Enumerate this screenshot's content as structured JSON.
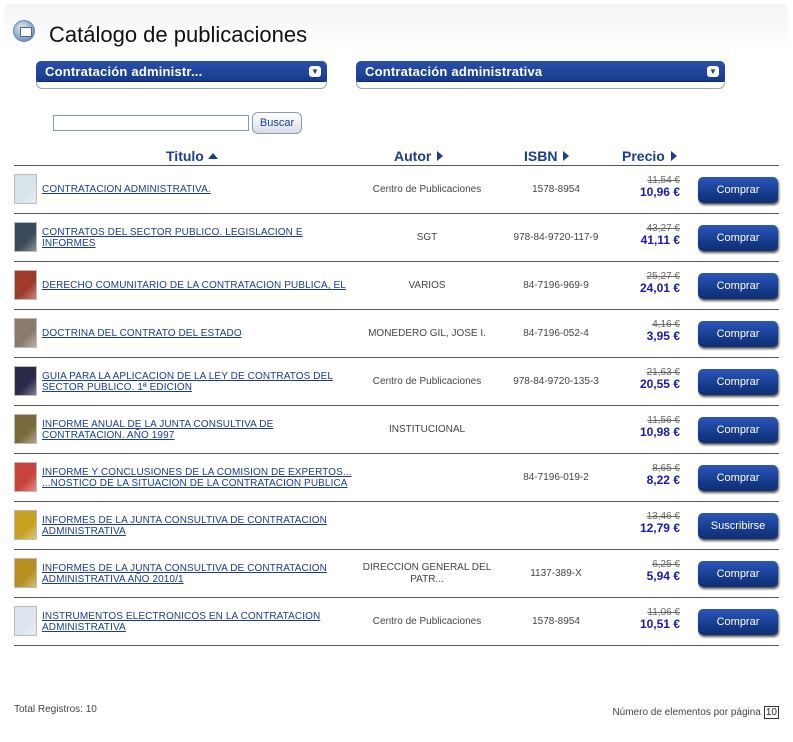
{
  "header": {
    "title": "Catálogo de publicaciones"
  },
  "filters": {
    "category_left": "Contratación administr...",
    "category_right": "Contratación administrativa"
  },
  "search": {
    "value": "",
    "placeholder": "",
    "button_label": "Buscar"
  },
  "table": {
    "headers": {
      "titulo": "Titulo",
      "autor": "Autor",
      "isbn": "ISBN",
      "precio": "Precio"
    },
    "sort": {
      "column": "titulo",
      "direction": "asc"
    },
    "rows": [
      {
        "title": "CONTRATACION ADMINISTRATIVA.",
        "author": "Centro de Publicaciones",
        "isbn": "1578-8954",
        "old_price": "11,54 €",
        "price": "10,96 €",
        "action": "Comprar",
        "thumb_color": "#d9e3ea"
      },
      {
        "title": "CONTRATOS DEL SECTOR PUBLICO. LEGISLACION E INFORMES",
        "author": "SGT",
        "isbn": "978-84-9720-117-9",
        "old_price": "43,27 €",
        "price": "41,11 €",
        "action": "Comprar",
        "thumb_color": "#3a4a5a"
      },
      {
        "title": "DERECHO COMUNITARIO DE LA CONTRATACION PUBLICA, EL",
        "author": "VARIOS",
        "isbn": "84-7196-969-9",
        "old_price": "25,27 €",
        "price": "24,01 €",
        "action": "Comprar",
        "thumb_color": "#a03a2a"
      },
      {
        "title": "DOCTRINA DEL CONTRATO DEL ESTADO",
        "author": "MONEDERO GIL, JOSE I.",
        "isbn": "84-7196-052-4",
        "old_price": "4,16 €",
        "price": "3,95 €",
        "action": "Comprar",
        "thumb_color": "#8a7a6a"
      },
      {
        "title": "GUIA PARA LA APLICACION DE LA LEY DE CONTRATOS DEL SECTOR PUBLICO. 1ª EDICION",
        "author": "Centro de Publicaciones",
        "isbn": "978-84-9720-135-3",
        "old_price": "21,63 €",
        "price": "20,55 €",
        "action": "Comprar",
        "thumb_color": "#2a2a4a"
      },
      {
        "title": "INFORME ANUAL DE LA JUNTA CONSULTIVA DE CONTRATACION. AÑO 1997",
        "author": "INSTITUCIONAL",
        "isbn": "",
        "old_price": "11,56 €",
        "price": "10,98 €",
        "action": "Comprar",
        "thumb_color": "#7a6a3a"
      },
      {
        "title": "INFORME Y CONCLUSIONES DE LA COMISION DE EXPERTOS... ...NOSTICO DE LA SITUACION DE LA CONTRATACION PUBLICA",
        "author": "",
        "isbn": "84-7196-019-2",
        "old_price": "8,65 €",
        "price": "8,22 €",
        "action": "Comprar",
        "thumb_color": "#c8443a"
      },
      {
        "title": "INFORMES DE LA JUNTA CONSULTIVA DE CONTRATACION ADMINISTRATIVA",
        "author": "",
        "isbn": "",
        "old_price": "13,46 €",
        "price": "12,79 €",
        "action": "Suscribirse",
        "thumb_color": "#c8a020"
      },
      {
        "title": "INFORMES DE LA JUNTA CONSULTIVA DE CONTRATACION ADMINISTRATIVA AÑO 2010/1",
        "author": "DIRECCION GENERAL DEL PATR...",
        "isbn": "1137-389-X",
        "old_price": "6,25 €",
        "price": "5,94 €",
        "action": "Comprar",
        "thumb_color": "#b89020"
      },
      {
        "title": "INSTRUMENTOS ELECTRONICOS EN LA CONTRATACION ADMINISTRATIVA",
        "author": "Centro de Publicaciones",
        "isbn": "1578-8954",
        "old_price": "11,06 €",
        "price": "10,51 €",
        "action": "Comprar",
        "thumb_color": "#dce4ee"
      }
    ]
  },
  "footer": {
    "total_label": "Total Registros: 10",
    "per_page_label": "Número de elementos por página",
    "per_page_value": "10"
  }
}
